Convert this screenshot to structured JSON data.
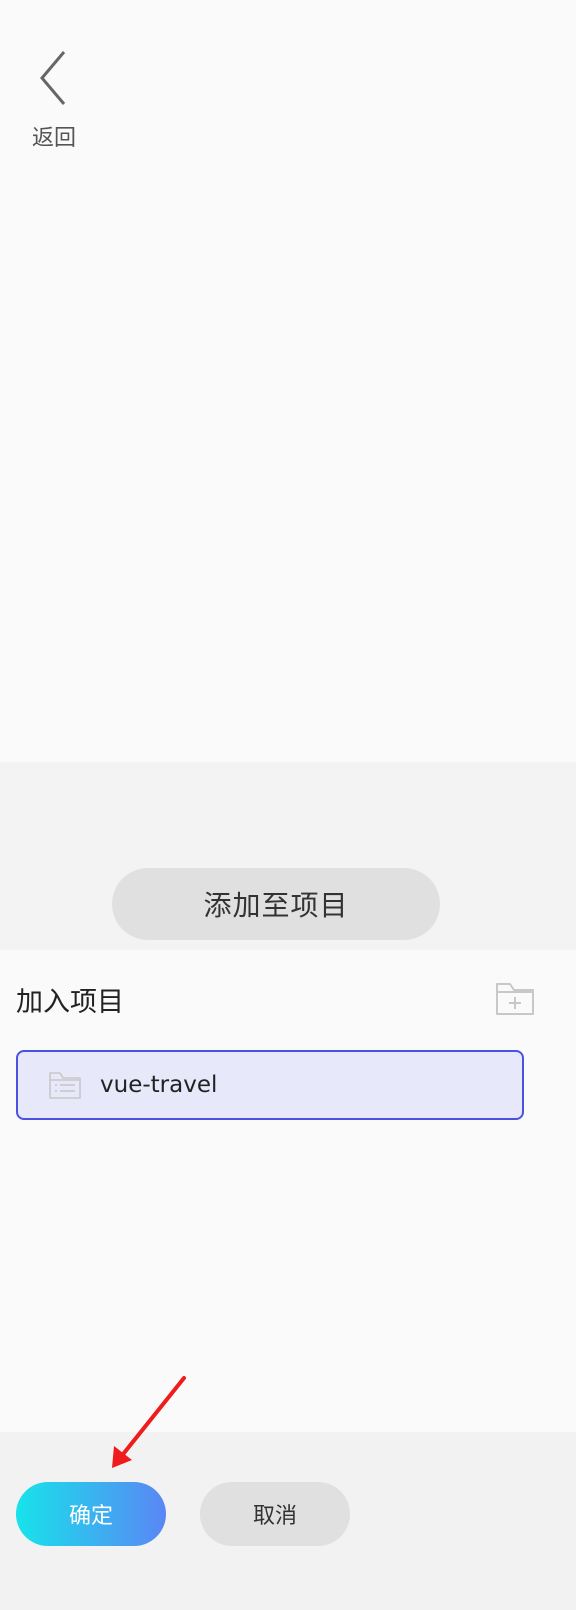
{
  "header": {
    "back_label": "返回",
    "back_icon": "chevron-left-icon"
  },
  "band": {
    "add_to_project_label": "添加至项目"
  },
  "section": {
    "title": "加入项目",
    "new_folder_icon": "folder-plus-icon"
  },
  "projects": [
    {
      "name": "vue-travel",
      "icon": "folder-list-icon",
      "selected": true
    }
  ],
  "footer": {
    "confirm_label": "确定",
    "cancel_label": "取消"
  },
  "colors": {
    "selected_border": "#4a52e0",
    "selected_bg": "#e7e9fb",
    "confirm_gradient_start": "#17e3ea",
    "confirm_gradient_end": "#5a86f5",
    "annotation_arrow": "#ee1c1c"
  }
}
